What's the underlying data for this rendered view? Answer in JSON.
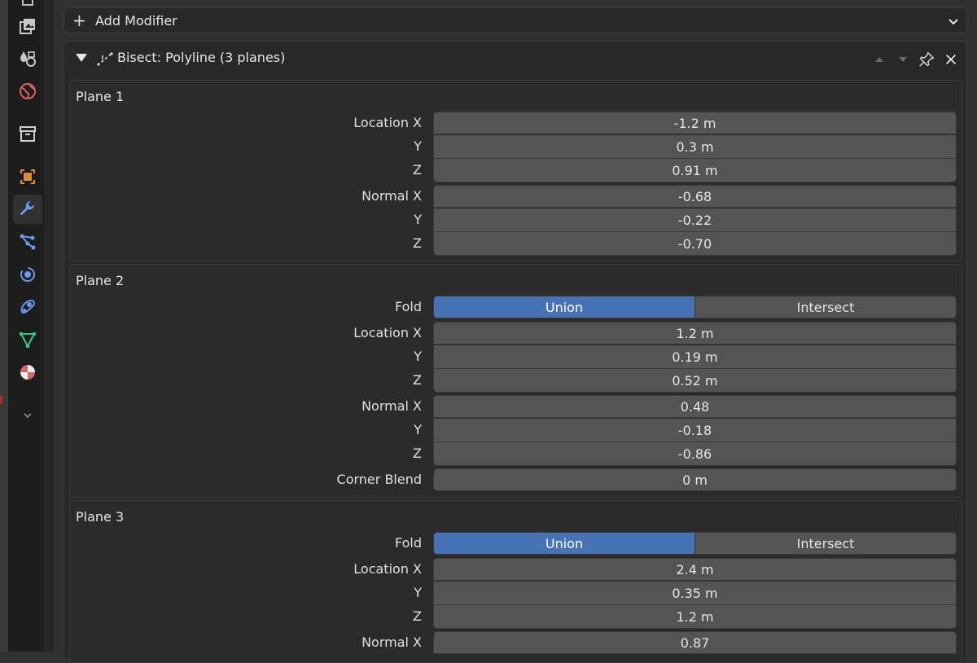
{
  "add_modifier": {
    "label": "Add Modifier"
  },
  "modifier": {
    "title": "Bisect: Polyline (3 planes)",
    "planes": [
      {
        "title": "Plane 1",
        "location_label": "Location X",
        "normal_label": "Normal X",
        "y_label": "Y",
        "z_label": "Z",
        "location": [
          "-1.2 m",
          "0.3 m",
          "0.91 m"
        ],
        "normal": [
          "-0.68",
          "-0.22",
          "-0.70"
        ]
      },
      {
        "title": "Plane 2",
        "fold_label": "Fold",
        "fold_options": [
          "Union",
          "Intersect"
        ],
        "fold_selected": "Union",
        "location_label": "Location X",
        "normal_label": "Normal X",
        "y_label": "Y",
        "z_label": "Z",
        "location": [
          "1.2 m",
          "0.19 m",
          "0.52 m"
        ],
        "normal": [
          "0.48",
          "-0.18",
          "-0.86"
        ],
        "corner_blend_label": "Corner Blend",
        "corner_blend": "0 m"
      },
      {
        "title": "Plane 3",
        "fold_label": "Fold",
        "fold_options": [
          "Union",
          "Intersect"
        ],
        "fold_selected": "Union",
        "location_label": "Location X",
        "normal_label": "Normal X",
        "y_label": "Y",
        "z_label": "Z",
        "location": [
          "2.4 m",
          "0.35 m",
          "1.2 m"
        ],
        "normal": [
          "0.87"
        ]
      }
    ]
  },
  "tabs": [
    "tool",
    "render",
    "output",
    "view-layer",
    "scene",
    "world",
    "collection",
    "object",
    "modifiers",
    "particles",
    "physics",
    "constraints",
    "data",
    "material"
  ],
  "active_tab": "modifiers",
  "colors": {
    "accent": "#4772b3",
    "field": "#545454",
    "panel": "#282828",
    "wrench": "#6a9bea"
  }
}
